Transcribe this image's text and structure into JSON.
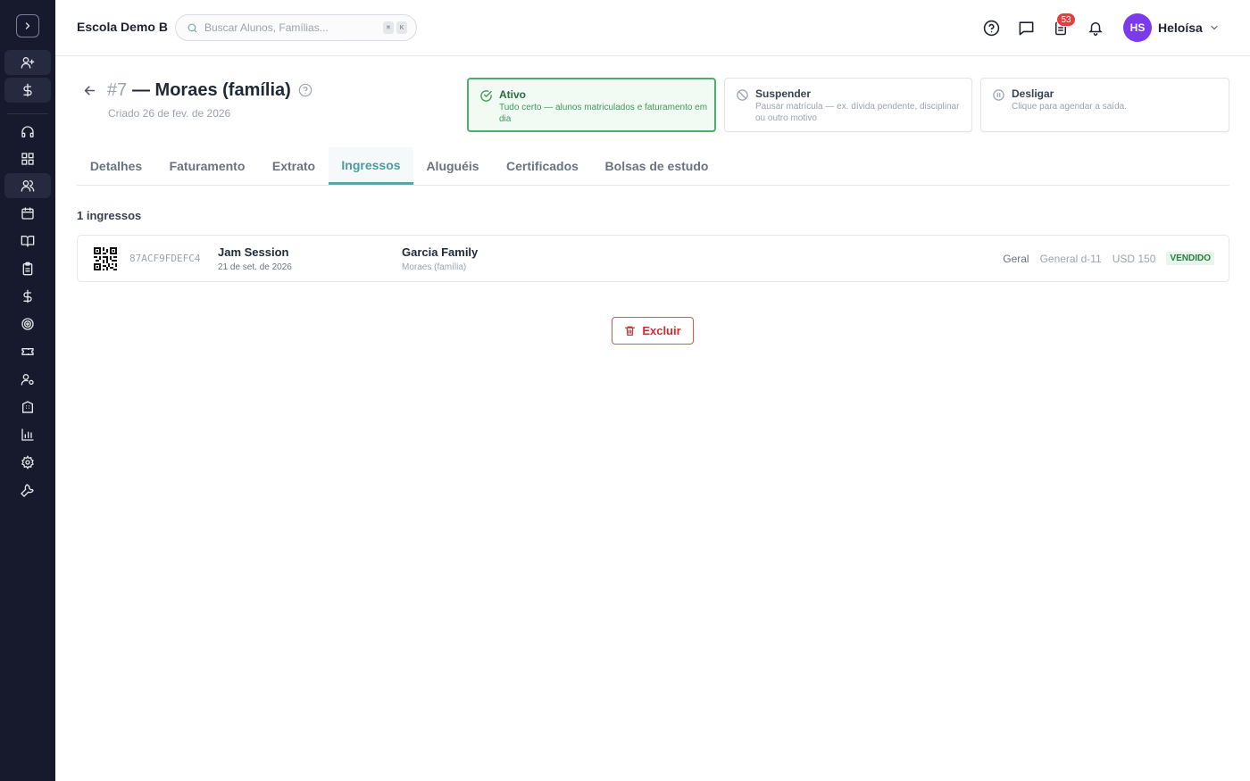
{
  "app": {
    "school_name": "Escola Demo B",
    "search_placeholder": "Buscar Alunos, Famílias...",
    "search_shortcut": [
      "⌘",
      "K"
    ],
    "notifications_badge": "53",
    "user": {
      "initials": "HS",
      "name": "Heloísa",
      "avatar_color": "#7c3aed"
    }
  },
  "sidebar": {
    "icons": [
      "chevron-right-icon",
      "user-plus-icon",
      "dollar-icon",
      "headset-icon",
      "grid-icon",
      "users-icon",
      "calendar-icon",
      "book-open-icon",
      "clipboard-icon",
      "dollar-icon",
      "target-icon",
      "ticket-icon",
      "user-cog-icon",
      "building-icon",
      "bar-chart-icon",
      "settings-icon",
      "wrench-icon"
    ]
  },
  "page": {
    "number": "#7",
    "title": "— Moraes (família)",
    "created": "Criado 26 de fev. de 2026"
  },
  "status_cards": [
    {
      "title": "Ativo",
      "description": "Tudo certo — alunos matriculados e faturamento em dia",
      "selected": true
    },
    {
      "title": "Suspender",
      "description": "Pausar matrícula — ex. dívida pendente, disciplinar ou outro motivo",
      "selected": false
    },
    {
      "title": "Desligar",
      "description": "Clique para agendar a saída.",
      "selected": false
    }
  ],
  "tabs": [
    {
      "label": "Detalhes",
      "active": false
    },
    {
      "label": "Faturamento",
      "active": false
    },
    {
      "label": "Extrato",
      "active": false
    },
    {
      "label": "Ingressos",
      "active": true
    },
    {
      "label": "Aluguéis",
      "active": false
    },
    {
      "label": "Certificados",
      "active": false
    },
    {
      "label": "Bolsas de estudo",
      "active": false
    }
  ],
  "tickets_count": "1 ingressos",
  "tickets": [
    {
      "code": "87ACF9FDEFC4",
      "event": "Jam Session",
      "date": "21 de set. de 2026",
      "family": "Garcia Family",
      "family_sub": "Moraes (família)",
      "category": "Geral",
      "section": "General d-11",
      "price": "USD 150",
      "status": "VENDIDO"
    }
  ],
  "actions": {
    "delete_label": "Excluir"
  },
  "colors": {
    "accent": "#5aa3a8",
    "success": "#4caf6d",
    "danger": "#d9534f",
    "sidebar_bg": "#171a2c"
  }
}
